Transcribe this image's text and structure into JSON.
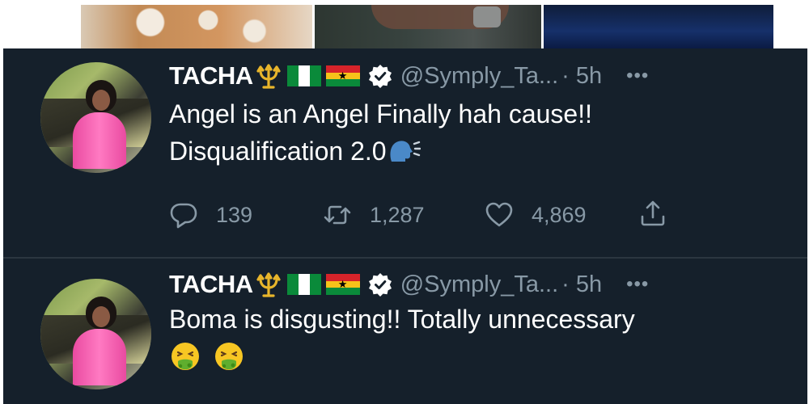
{
  "colors": {
    "background": "#15202b",
    "primary_text": "#ffffff",
    "secondary_text": "#8899a6",
    "divider": "#2b3640"
  },
  "top_images": [
    "sand-texture-photo",
    "hand-with-watch-photo",
    "blue-night-photo"
  ],
  "tweets": [
    {
      "author_name": "TACHA",
      "author_emojis": [
        "trident-icon",
        "nigeria-flag",
        "ghana-flag"
      ],
      "verified": true,
      "handle": "@Symply_Ta...",
      "time": "· 5h",
      "more": "•••",
      "text_line_1": "Angel is an Angel Finally hah cause!!",
      "text_line_2": "Disqualification 2.0",
      "trailing_emoji": "speaking-head-icon",
      "replies": "139",
      "retweets": "1,287",
      "likes": "4,869"
    },
    {
      "author_name": "TACHA",
      "author_emojis": [
        "trident-icon",
        "nigeria-flag",
        "ghana-flag"
      ],
      "verified": true,
      "handle": "@Symply_Ta...",
      "time": "· 5h",
      "more": "•••",
      "text_line_1": "Boma is disgusting!! Totally unnecessary",
      "trailing_emoji": "nauseated-face-icon"
    }
  ]
}
